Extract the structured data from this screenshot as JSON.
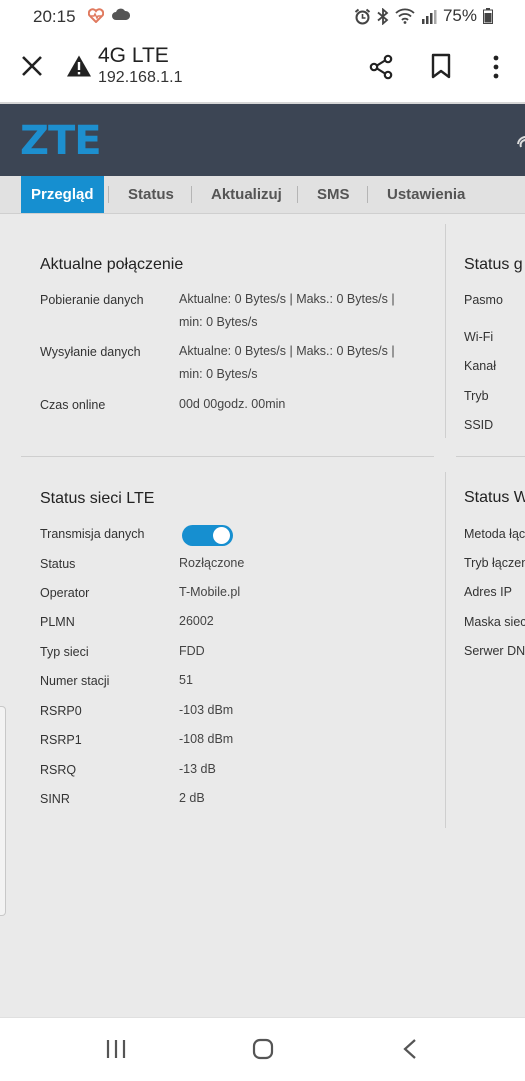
{
  "status_bar": {
    "time": "20:15",
    "battery": "75%"
  },
  "browser": {
    "tab_title": "4G LTE",
    "url": "192.168.1.1"
  },
  "router": {
    "logo": "ZTE",
    "nav": [
      "Przegląd",
      "Status",
      "Aktualizuj",
      "SMS",
      "Ustawienia"
    ]
  },
  "connection": {
    "title": "Aktualne połączenie",
    "rows": [
      {
        "label": "Pobieranie danych",
        "value_line1": "Aktualne: 0 Bytes/s | Maks.: 0 Bytes/s |",
        "value_line2": "min: 0 Bytes/s"
      },
      {
        "label": "Wysyłanie danych",
        "value_line1": "Aktualne: 0 Bytes/s | Maks.: 0 Bytes/s |",
        "value_line2": "min: 0 Bytes/s"
      },
      {
        "label": "Czas online",
        "value_line1": "00d 00godz. 00min"
      }
    ]
  },
  "lte": {
    "title": "Status sieci LTE",
    "toggle_label": "Transmisja danych",
    "toggle_on": true,
    "rows": [
      {
        "label": "Status",
        "value": "Rozłączone"
      },
      {
        "label": "Operator",
        "value": "T-Mobile.pl"
      },
      {
        "label": "PLMN",
        "value": "26002"
      },
      {
        "label": "Typ sieci",
        "value": "FDD"
      },
      {
        "label": "Numer stacji",
        "value": "51"
      },
      {
        "label": "RSRP0",
        "value": "-103 dBm"
      },
      {
        "label": "RSRP1",
        "value": "-108 dBm"
      },
      {
        "label": "RSRQ",
        "value": "-13 dB"
      },
      {
        "label": "SINR",
        "value": "2 dB"
      }
    ]
  },
  "right_top": {
    "title": "Status g",
    "labels": [
      "Pasmo",
      "Wi-Fi",
      "Kanał",
      "Tryb",
      "SSID"
    ]
  },
  "right_bottom": {
    "title": "Status W",
    "labels": [
      "Metoda łąc",
      "Tryb łączen",
      "Adres IP",
      "Maska siec",
      "Serwer DN"
    ]
  },
  "colors": {
    "accent": "#168fd0",
    "header_bg": "#3c4554",
    "content_bg": "#eaeaea"
  }
}
